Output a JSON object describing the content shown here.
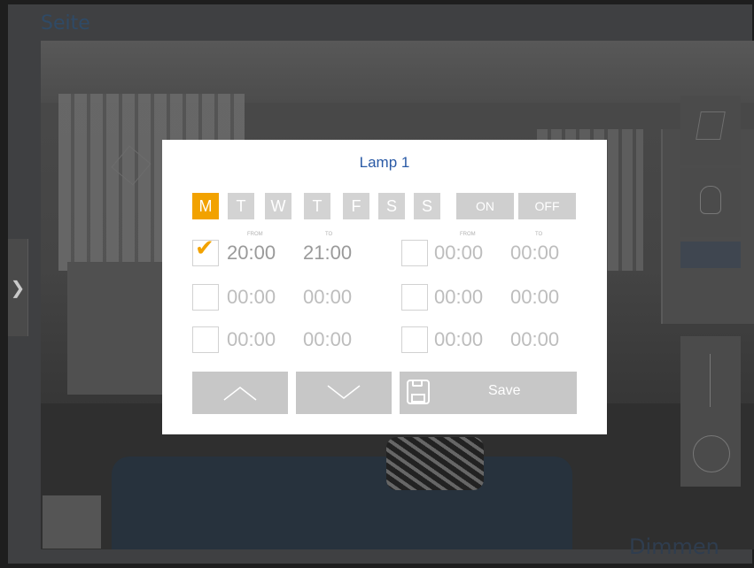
{
  "page": {
    "title": "Seite",
    "bottom_label": "Dimmen",
    "side_nav_glyph": "❯"
  },
  "dialog": {
    "title": "Lamp 1",
    "days": [
      "M",
      "T",
      "W",
      "T",
      "F",
      "S",
      "S"
    ],
    "active_day_index": 0,
    "on_label": "ON",
    "off_label": "OFF",
    "from_label": "FROM",
    "to_label": "TO",
    "slots": [
      {
        "checked": true,
        "from": "20:00",
        "to": "21:00"
      },
      {
        "checked": false,
        "from": "00:00",
        "to": "00:00"
      },
      {
        "checked": false,
        "from": "00:00",
        "to": "00:00"
      },
      {
        "checked": false,
        "from": "00:00",
        "to": "00:00"
      },
      {
        "checked": false,
        "from": "00:00",
        "to": "00:00"
      },
      {
        "checked": false,
        "from": "00:00",
        "to": "00:00"
      }
    ],
    "save_label": "Save",
    "check_glyph": "✔"
  },
  "icons": {
    "side_nav": "chevron-right-icon",
    "up": "chevron-up-icon",
    "down": "chevron-down-icon",
    "save": "floppy-disk-icon"
  },
  "colors": {
    "accent": "#f2a200",
    "title": "#2a5aa6",
    "button": "#c7c7c7",
    "day_inactive": "#d3d3d3",
    "time_text": "#bdbdbd"
  }
}
